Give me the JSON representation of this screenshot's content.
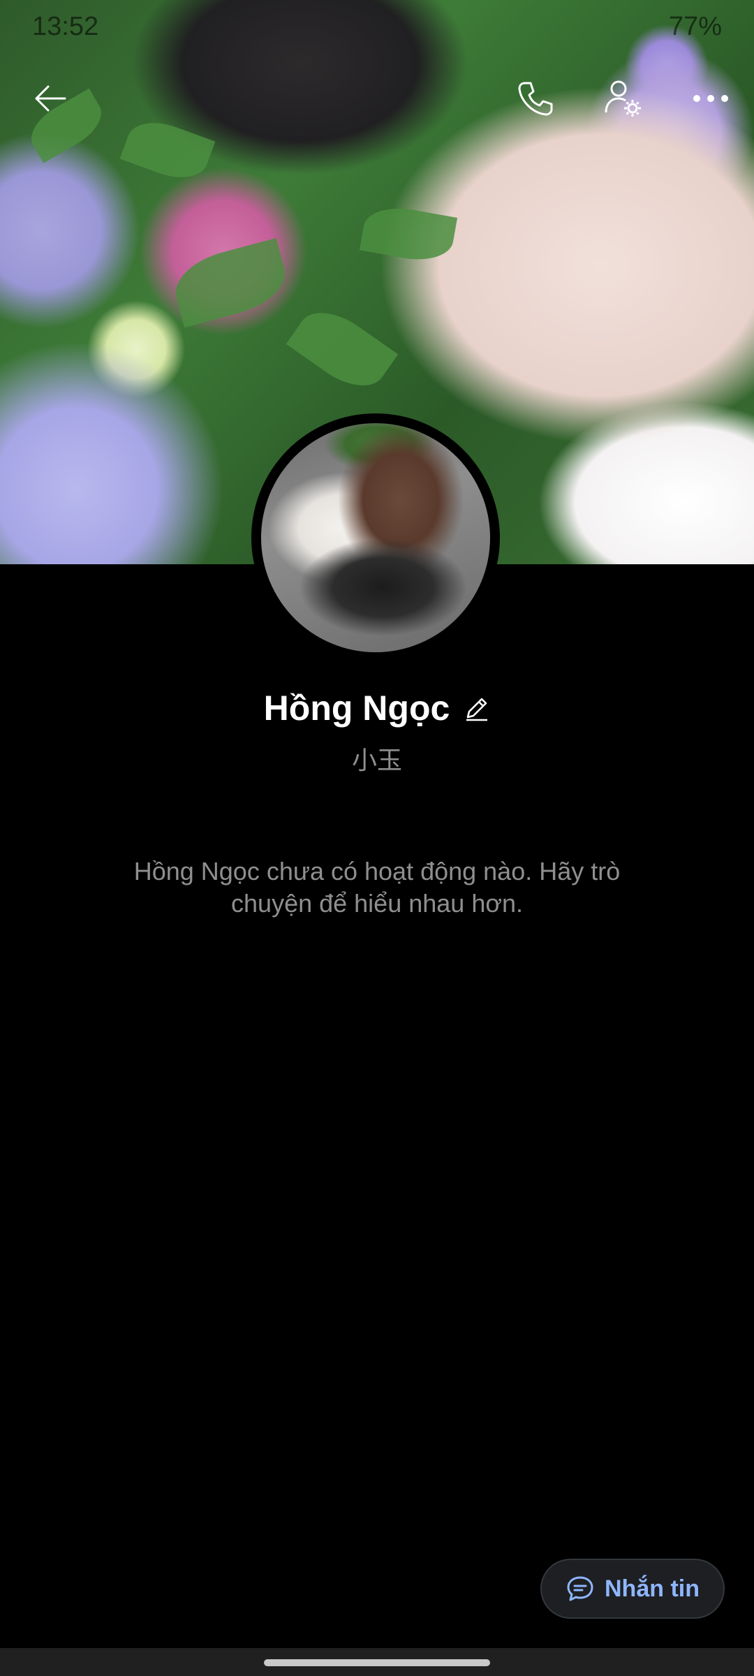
{
  "status_bar": {
    "time": "13:52",
    "battery": "77%"
  },
  "profile": {
    "name": "Hồng Ngọc",
    "alias": "小玉",
    "empty_message": "Hồng Ngọc chưa có hoạt động nào. Hãy trò chuyện để hiểu nhau hơn."
  },
  "actions": {
    "message_button_label": "Nhắn tin"
  },
  "icons": {
    "back": "back-arrow-icon",
    "call": "phone-icon",
    "settings": "user-settings-icon",
    "more": "more-icon",
    "edit": "edit-pencil-icon",
    "chat": "chat-bubble-icon"
  },
  "colors": {
    "background": "#000000",
    "accent": "#8fb6ff",
    "secondary_text": "#8f8f8f"
  }
}
